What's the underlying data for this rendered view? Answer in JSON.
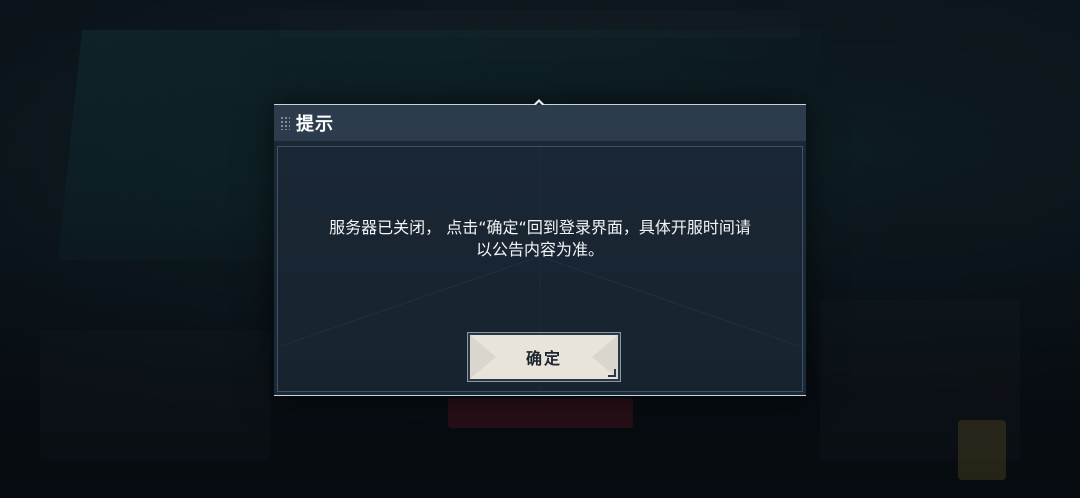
{
  "dialog": {
    "title": "提示",
    "message_line1": "服务器已关闭， 点击“确定“回到登录界面，具体开服时间请",
    "message_line2": "以公告内容为准。",
    "confirm_label": "确定"
  },
  "icons": {
    "title_grip": "grip-dots-icon",
    "top_ornament": "diamond-arrow-icon"
  },
  "colors": {
    "title_bar": "#2c3c4c",
    "dialog_body": "#1b2835",
    "button_bg": "#e9e4da",
    "text_primary": "#ffffff"
  }
}
